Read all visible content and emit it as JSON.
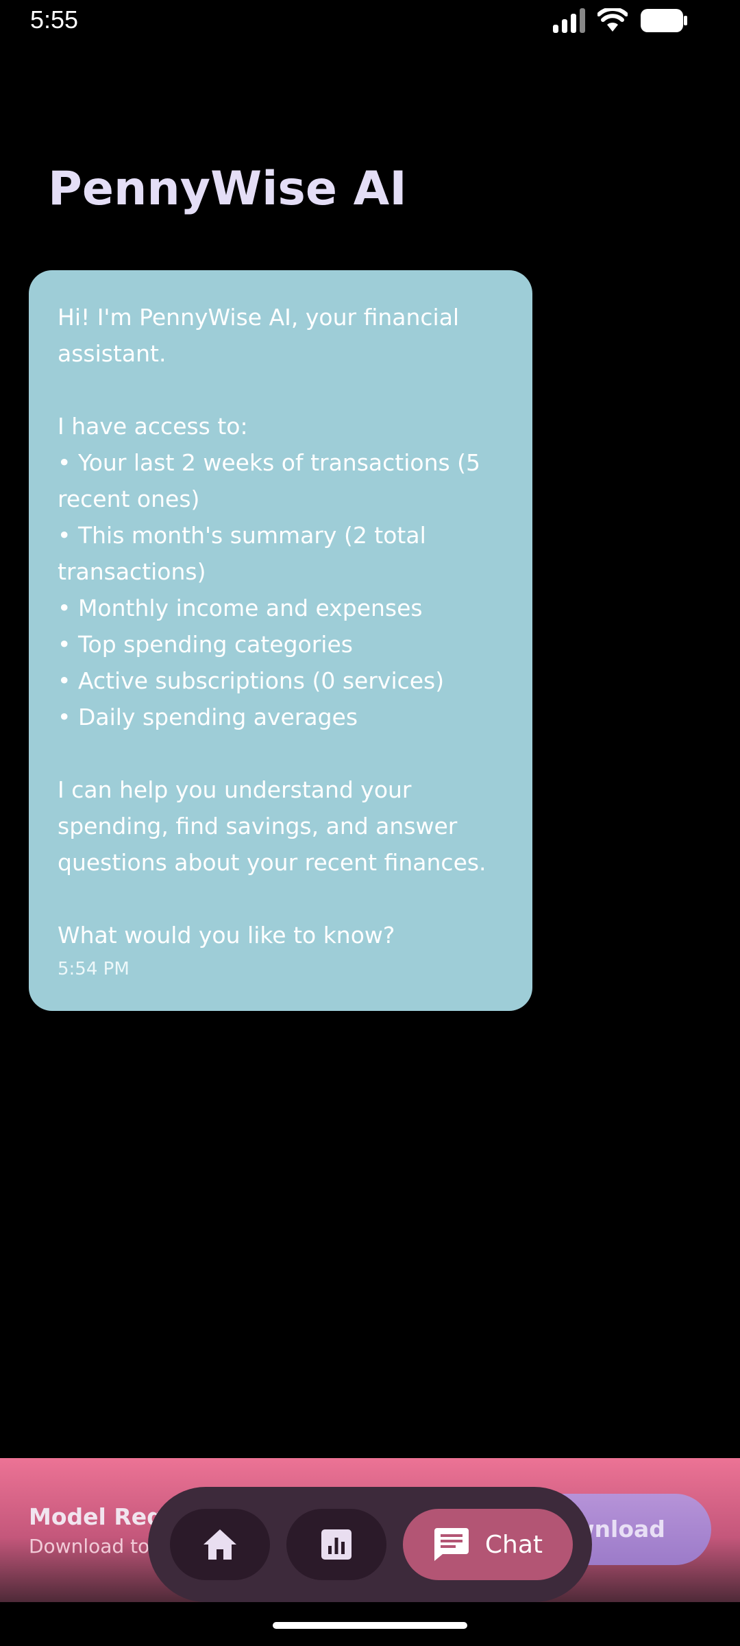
{
  "status_bar": {
    "time": "5:55",
    "icons": [
      "signal-icon",
      "wifi-icon",
      "battery-icon"
    ]
  },
  "header": {
    "title": "PennyWise AI"
  },
  "message": {
    "text": "Hi! I'm PennyWise AI, your financial\nassistant.\n\nI have access to:\n• Your last 2 weeks of transactions (5\nrecent ones)\n• This month's summary (2 total\ntransactions)\n• Monthly income and expenses\n• Top spending categories\n• Active subscriptions (0 services)\n• Daily spending averages\n\nI can help you understand your\nspending, find savings, and answer\nquestions about your recent finances.\n\nWhat would you like to know?",
    "time": "5:54 PM",
    "bubble_color": "#9ecdd7"
  },
  "banner": {
    "title": "Model Req",
    "subtitle": "Download to",
    "button_label": "wnload"
  },
  "nav": {
    "items": [
      {
        "icon": "home-icon"
      },
      {
        "icon": "bar-chart-icon"
      },
      {
        "icon": "chat-icon",
        "label": "Chat",
        "active": true
      }
    ]
  },
  "colors": {
    "background": "#000000",
    "title": "#e4def6",
    "accent": "#b35574",
    "banner_pink": "#ec7395"
  }
}
